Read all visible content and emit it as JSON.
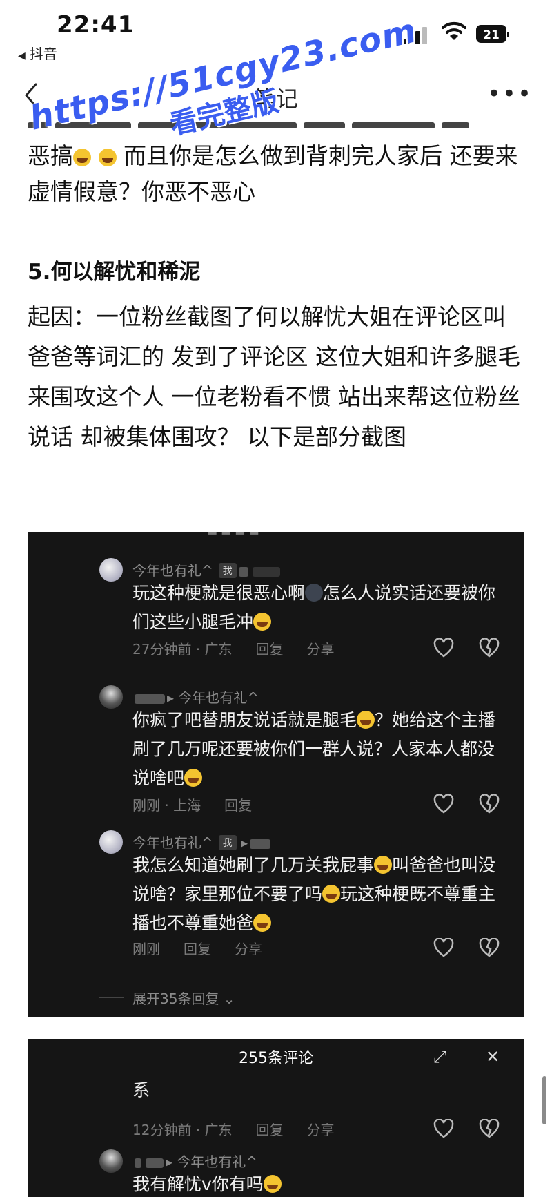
{
  "status_bar": {
    "time": "22:41",
    "back_app": "抖音",
    "battery": "21"
  },
  "nav": {
    "title": "笔记"
  },
  "watermark": {
    "line1": "https://51cgy23.com",
    "line2": "看完整版"
  },
  "article": {
    "paragraph_prefix": "恶搞",
    "paragraph_mid": " 而且你是怎么做到背刺完人家后 还要来虚情假意？你恶不恶心",
    "section_title": "5.何以解忧和稀泥",
    "cause": "起因：一位粉丝截图了何以解忧大姐在评论区叫爸爸等词汇的 发到了评论区 这位大姐和许多腿毛来围攻这个人 一位老粉看不惯 站出来帮这位粉丝说话 却被集体围攻？ 以下是部分截图"
  },
  "comments": [
    {
      "user": "今年也有礼^",
      "tag": "我",
      "text_a": "玩这种梗就是很恶心啊",
      "text_b": "怎么人说实话还要被你们这些小腿毛冲",
      "time": "27分钟前 · 广东",
      "reply": "回复",
      "share": "分享"
    },
    {
      "user": "今年也有礼^",
      "text_a": "你疯了吧替朋友说话就是腿毛",
      "text_b": "？她给这个主播刷了几万呢还要被你们一群人说？人家本人都没说啥吧",
      "time": "刚刚 · 上海",
      "reply": "回复"
    },
    {
      "user": "今年也有礼^",
      "tag": "我",
      "text_a": "我怎么知道她刷了几万关我屁事",
      "text_b": "叫爸爸也叫没说啥？家里那位不要了吗",
      "text_c": "玩这种梗既不尊重主播也不尊重她爸",
      "time": "刚刚",
      "reply": "回复",
      "share": "分享"
    }
  ],
  "expand_replies": "展开35条回复",
  "panel2": {
    "title": "255条评论",
    "comment_tail": "系",
    "time": "12分钟前 · 广东",
    "reply": "回复",
    "share": "分享",
    "next_user": "今年也有礼^",
    "next_text": "我有解忧v你有吗"
  }
}
